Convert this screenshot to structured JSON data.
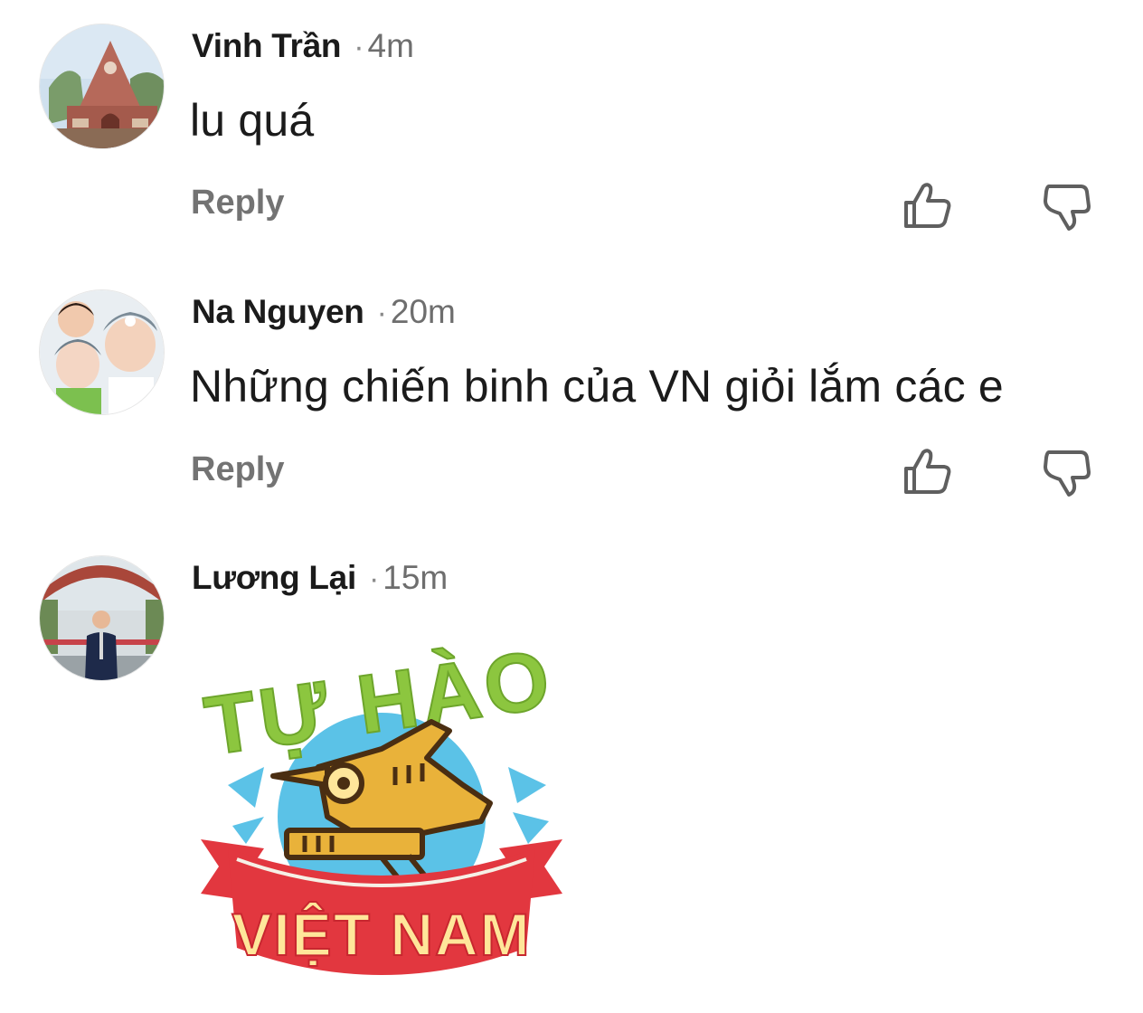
{
  "comments": [
    {
      "author": "Vinh Trần",
      "separator": "·",
      "time": "4m",
      "text": "lu quá",
      "reply_label": "Reply",
      "avatar_icon": "church-photo-avatar"
    },
    {
      "author": "Na Nguyen",
      "separator": "·",
      "time": "20m",
      "text": "Những chiến binh của VN giỏi lắm các e",
      "reply_label": "Reply",
      "avatar_icon": "family-photo-avatar"
    },
    {
      "author": "Lương Lại",
      "separator": "·",
      "time": "15m",
      "sticker": {
        "top_text": "TỰ HÀO",
        "banner_text": "VIỆT NAM",
        "icon": "lac-bird-sticker"
      },
      "avatar_icon": "man-in-suit-photo-avatar"
    }
  ],
  "icons": {
    "like": "thumbs-up-icon",
    "dislike": "thumbs-down-icon"
  },
  "colors": {
    "author": "#1b1b1b",
    "time": "#6e6e6e",
    "reply": "#737373",
    "icon_stroke": "#5f5f5f",
    "sticker_green": "#8cc63f",
    "sticker_red": "#e2373f",
    "sticker_blue": "#5bc2e7",
    "sticker_gold": "#e9b23a",
    "sticker_cream": "#ffe69a"
  }
}
